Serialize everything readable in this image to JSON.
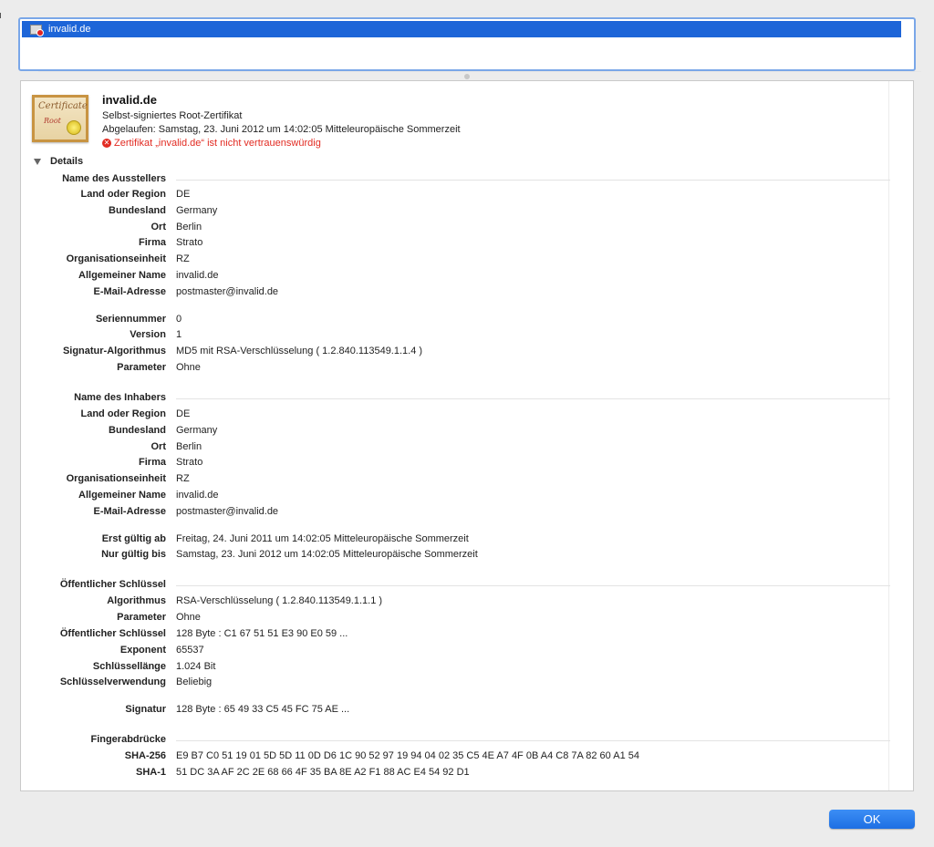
{
  "tree": {
    "selected_item": "invalid.de"
  },
  "header": {
    "title": "invalid.de",
    "subtitle": "Selbst-signiertes Root-Zertifikat",
    "expired": "Abgelaufen: Samstag, 23. Juni 2012 um 14:02:05 Mitteleuropäische Sommerzeit",
    "warning": "Zertifikat „invalid.de“ ist nicht vertrauenswürdig",
    "cert_icon_text_1": "Certificate",
    "cert_icon_text_2": "Root"
  },
  "details": {
    "toggle_label": "Details",
    "rows": [
      {
        "label": "Name des Ausstellers",
        "value": "",
        "section": true
      },
      {
        "label": "Land oder Region",
        "value": "DE"
      },
      {
        "label": "Bundesland",
        "value": "Germany"
      },
      {
        "label": "Ort",
        "value": "Berlin"
      },
      {
        "label": "Firma",
        "value": "Strato"
      },
      {
        "label": "Organisationseinheit",
        "value": "RZ"
      },
      {
        "label": "Allgemeiner Name",
        "value": "invalid.de"
      },
      {
        "label": "E-Mail-Adresse",
        "value": "postmaster@invalid.de"
      },
      {
        "label": "Seriennummer",
        "value": "0"
      },
      {
        "label": "Version",
        "value": "1"
      },
      {
        "label": "Signatur-Algorithmus",
        "value": "MD5 mit RSA-Verschlüsselung ( 1.2.840.113549.1.1.4 )"
      },
      {
        "label": "Parameter",
        "value": "Ohne"
      },
      {
        "label": "Name des Inhabers",
        "value": "",
        "section": true
      },
      {
        "label": "Land oder Region",
        "value": "DE"
      },
      {
        "label": "Bundesland",
        "value": "Germany"
      },
      {
        "label": "Ort",
        "value": "Berlin"
      },
      {
        "label": "Firma",
        "value": "Strato"
      },
      {
        "label": "Organisationseinheit",
        "value": "RZ"
      },
      {
        "label": "Allgemeiner Name",
        "value": "invalid.de"
      },
      {
        "label": "E-Mail-Adresse",
        "value": "postmaster@invalid.de"
      },
      {
        "label": "Erst gültig ab",
        "value": "Freitag, 24. Juni 2011 um 14:02:05 Mitteleuropäische Sommerzeit"
      },
      {
        "label": "Nur gültig bis",
        "value": "Samstag, 23. Juni 2012 um 14:02:05 Mitteleuropäische Sommerzeit"
      },
      {
        "label": "Öffentlicher Schlüssel",
        "value": "",
        "section": true
      },
      {
        "label": "Algorithmus",
        "value": "RSA-Verschlüsselung ( 1.2.840.113549.1.1.1 )"
      },
      {
        "label": "Parameter",
        "value": "Ohne"
      },
      {
        "label": "Öffentlicher Schlüssel",
        "value": "128 Byte : C1 67 51 51 E3 90 E0 59 ..."
      },
      {
        "label": "Exponent",
        "value": "65537"
      },
      {
        "label": "Schlüssellänge",
        "value": "1.024 Bit"
      },
      {
        "label": "Schlüsselverwendung",
        "value": "Beliebig"
      },
      {
        "label": "Signatur",
        "value": "128 Byte : 65 49 33 C5 45 FC 75 AE ..."
      },
      {
        "label": "Fingerabdrücke",
        "value": "",
        "section": true
      },
      {
        "label": "SHA-256",
        "value": "E9 B7 C0 51 19 01 5D 5D 11 0D D6 1C 90 52 97 19 94 04 02 35 C5 4E A7 4F 0B A4 C8 7A 82 60 A1 54"
      },
      {
        "label": "SHA-1",
        "value": "51 DC 3A AF 2C 2E 68 66 4F 35 BA 8E A2 F1 88 AC E4 54 92 D1"
      }
    ]
  },
  "footer": {
    "ok_label": "OK"
  }
}
